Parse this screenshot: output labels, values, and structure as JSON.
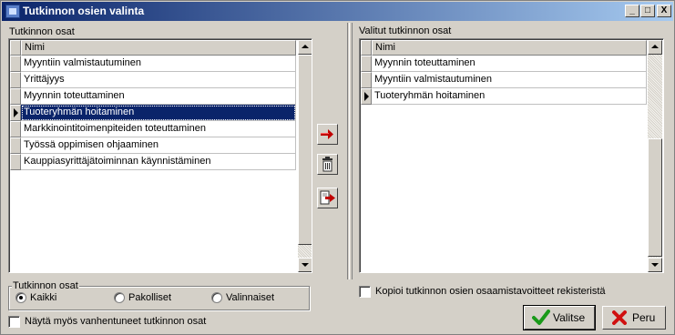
{
  "window": {
    "title": "Tutkinnon osien valinta",
    "controls": {
      "minimize": "_",
      "maximize": "□",
      "close": "X"
    }
  },
  "left_panel": {
    "label": "Tutkinnon osat",
    "column_header": "Nimi",
    "rows": [
      {
        "name": "Myyntiin valmistautuminen",
        "selected": false
      },
      {
        "name": "Yrittäjyys",
        "selected": false
      },
      {
        "name": "Myynnin toteuttaminen",
        "selected": false
      },
      {
        "name": "Tuoteryhmän hoitaminen",
        "selected": true
      },
      {
        "name": "Markkinointitoimenpiteiden toteuttaminen",
        "selected": false
      },
      {
        "name": "Työssä oppimisen ohjaaminen",
        "selected": false
      },
      {
        "name": "Kauppiasyrittäjätoiminnan käynnistäminen",
        "selected": false
      }
    ]
  },
  "right_panel": {
    "label": "Valitut tutkinnon osat",
    "column_header": "Nimi",
    "rows": [
      {
        "name": "Myynnin toteuttaminen",
        "current": false
      },
      {
        "name": "Myyntiin valmistautuminen",
        "current": false
      },
      {
        "name": "Tuoteryhmän hoitaminen",
        "current": true
      }
    ]
  },
  "toolbar": {
    "add_icon": "arrow-right-icon",
    "delete_icon": "trash-icon",
    "add_all_icon": "document-arrow-icon"
  },
  "filter": {
    "group_label": "Tutkinnon osat",
    "options": [
      {
        "label": "Kaikki",
        "checked": true
      },
      {
        "label": "Pakolliset",
        "checked": false
      },
      {
        "label": "Valinnaiset",
        "checked": false
      }
    ]
  },
  "show_expired": {
    "label": "Näytä myös vanhentuneet tutkinnon osat",
    "checked": false
  },
  "copy_goals": {
    "label": "Kopioi tutkinnon osien osaamistavoitteet rekisteristä",
    "checked": false
  },
  "buttons": {
    "ok": "Valitse",
    "cancel": "Peru"
  },
  "colors": {
    "titlebar": "#0a246a",
    "selection": "#0a246a",
    "face": "#d4d0c8",
    "ok_icon": "#1a9a1a",
    "cancel_icon": "#d01010"
  }
}
